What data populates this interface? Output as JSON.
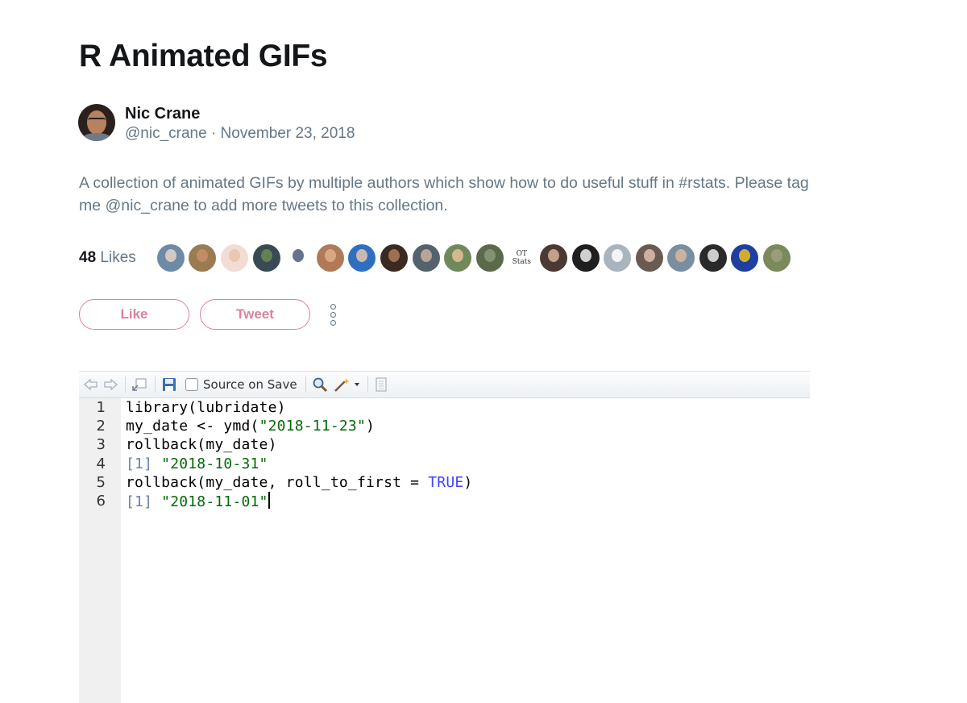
{
  "page": {
    "title": "R Animated GIFs"
  },
  "author": {
    "name": "Nic Crane",
    "meta": "@nic_crane · November 23, 2018"
  },
  "description": "A collection of animated GIFs by multiple authors which show how to do useful stuff in #rstats. Please tag me @nic_crane to add more tweets to this collection.",
  "likes": {
    "count": "48",
    "label": "Likes",
    "avatars": [
      {
        "bg": "#6d8aa6",
        "fg": "#e6d3c4"
      },
      {
        "bg": "#9a7b52",
        "fg": "#c98f6a"
      },
      {
        "bg": "#f2ddd4",
        "fg": "#e8c3aa"
      },
      {
        "bg": "#3a4a55",
        "fg": "#6b8a4e"
      },
      {
        "bg": "#ffffff",
        "fg": "#4a5a7a"
      },
      {
        "bg": "#b07a58",
        "fg": "#e0b08a"
      },
      {
        "bg": "#2f6fc0",
        "fg": "#e4c7b0"
      },
      {
        "bg": "#3b2a22",
        "fg": "#b07c5c"
      },
      {
        "bg": "#54616e",
        "fg": "#c7b39e"
      },
      {
        "bg": "#6f8a5a",
        "fg": "#e6c09a"
      },
      {
        "bg": "#5b6a4a",
        "fg": "#8a9a7a"
      },
      {
        "text": "OT\nStats"
      },
      {
        "bg": "#4a3a33",
        "fg": "#d8b39a"
      },
      {
        "bg": "#1f1f1f",
        "fg": "#f0f0f0"
      },
      {
        "bg": "#aab4bd",
        "fg": "#ffffff"
      },
      {
        "bg": "#6a5a52",
        "fg": "#e0bfae"
      },
      {
        "bg": "#7a8ea0",
        "fg": "#d9b9a0"
      },
      {
        "bg": "#2a2a2a",
        "fg": "#e8e8e8"
      },
      {
        "bg": "#1f3fa0",
        "fg": "#f0c020"
      },
      {
        "bg": "#7a8a5a",
        "fg": "#a0a080"
      }
    ]
  },
  "actions": {
    "like": "Like",
    "tweet": "Tweet"
  },
  "editor": {
    "source_on_save": "Source on Save",
    "lines": [
      {
        "n": "1"
      },
      {
        "n": "2"
      },
      {
        "n": "3"
      },
      {
        "n": "4"
      },
      {
        "n": "5"
      },
      {
        "n": "6"
      }
    ],
    "code": {
      "l1": "library(lubridate)",
      "l2a": "my_date <- ymd(",
      "l2b": "\"2018-11-23\"",
      "l2c": ")",
      "l3": "rollback(my_date)",
      "l4a": "[1] ",
      "l4b": "\"2018-10-31\"",
      "l5a": "rollback(my_date, roll_to_first = ",
      "l5b": "TRUE",
      "l5c": ")",
      "l6a": "[1] ",
      "l6b": "\"2018-11-01\""
    }
  }
}
